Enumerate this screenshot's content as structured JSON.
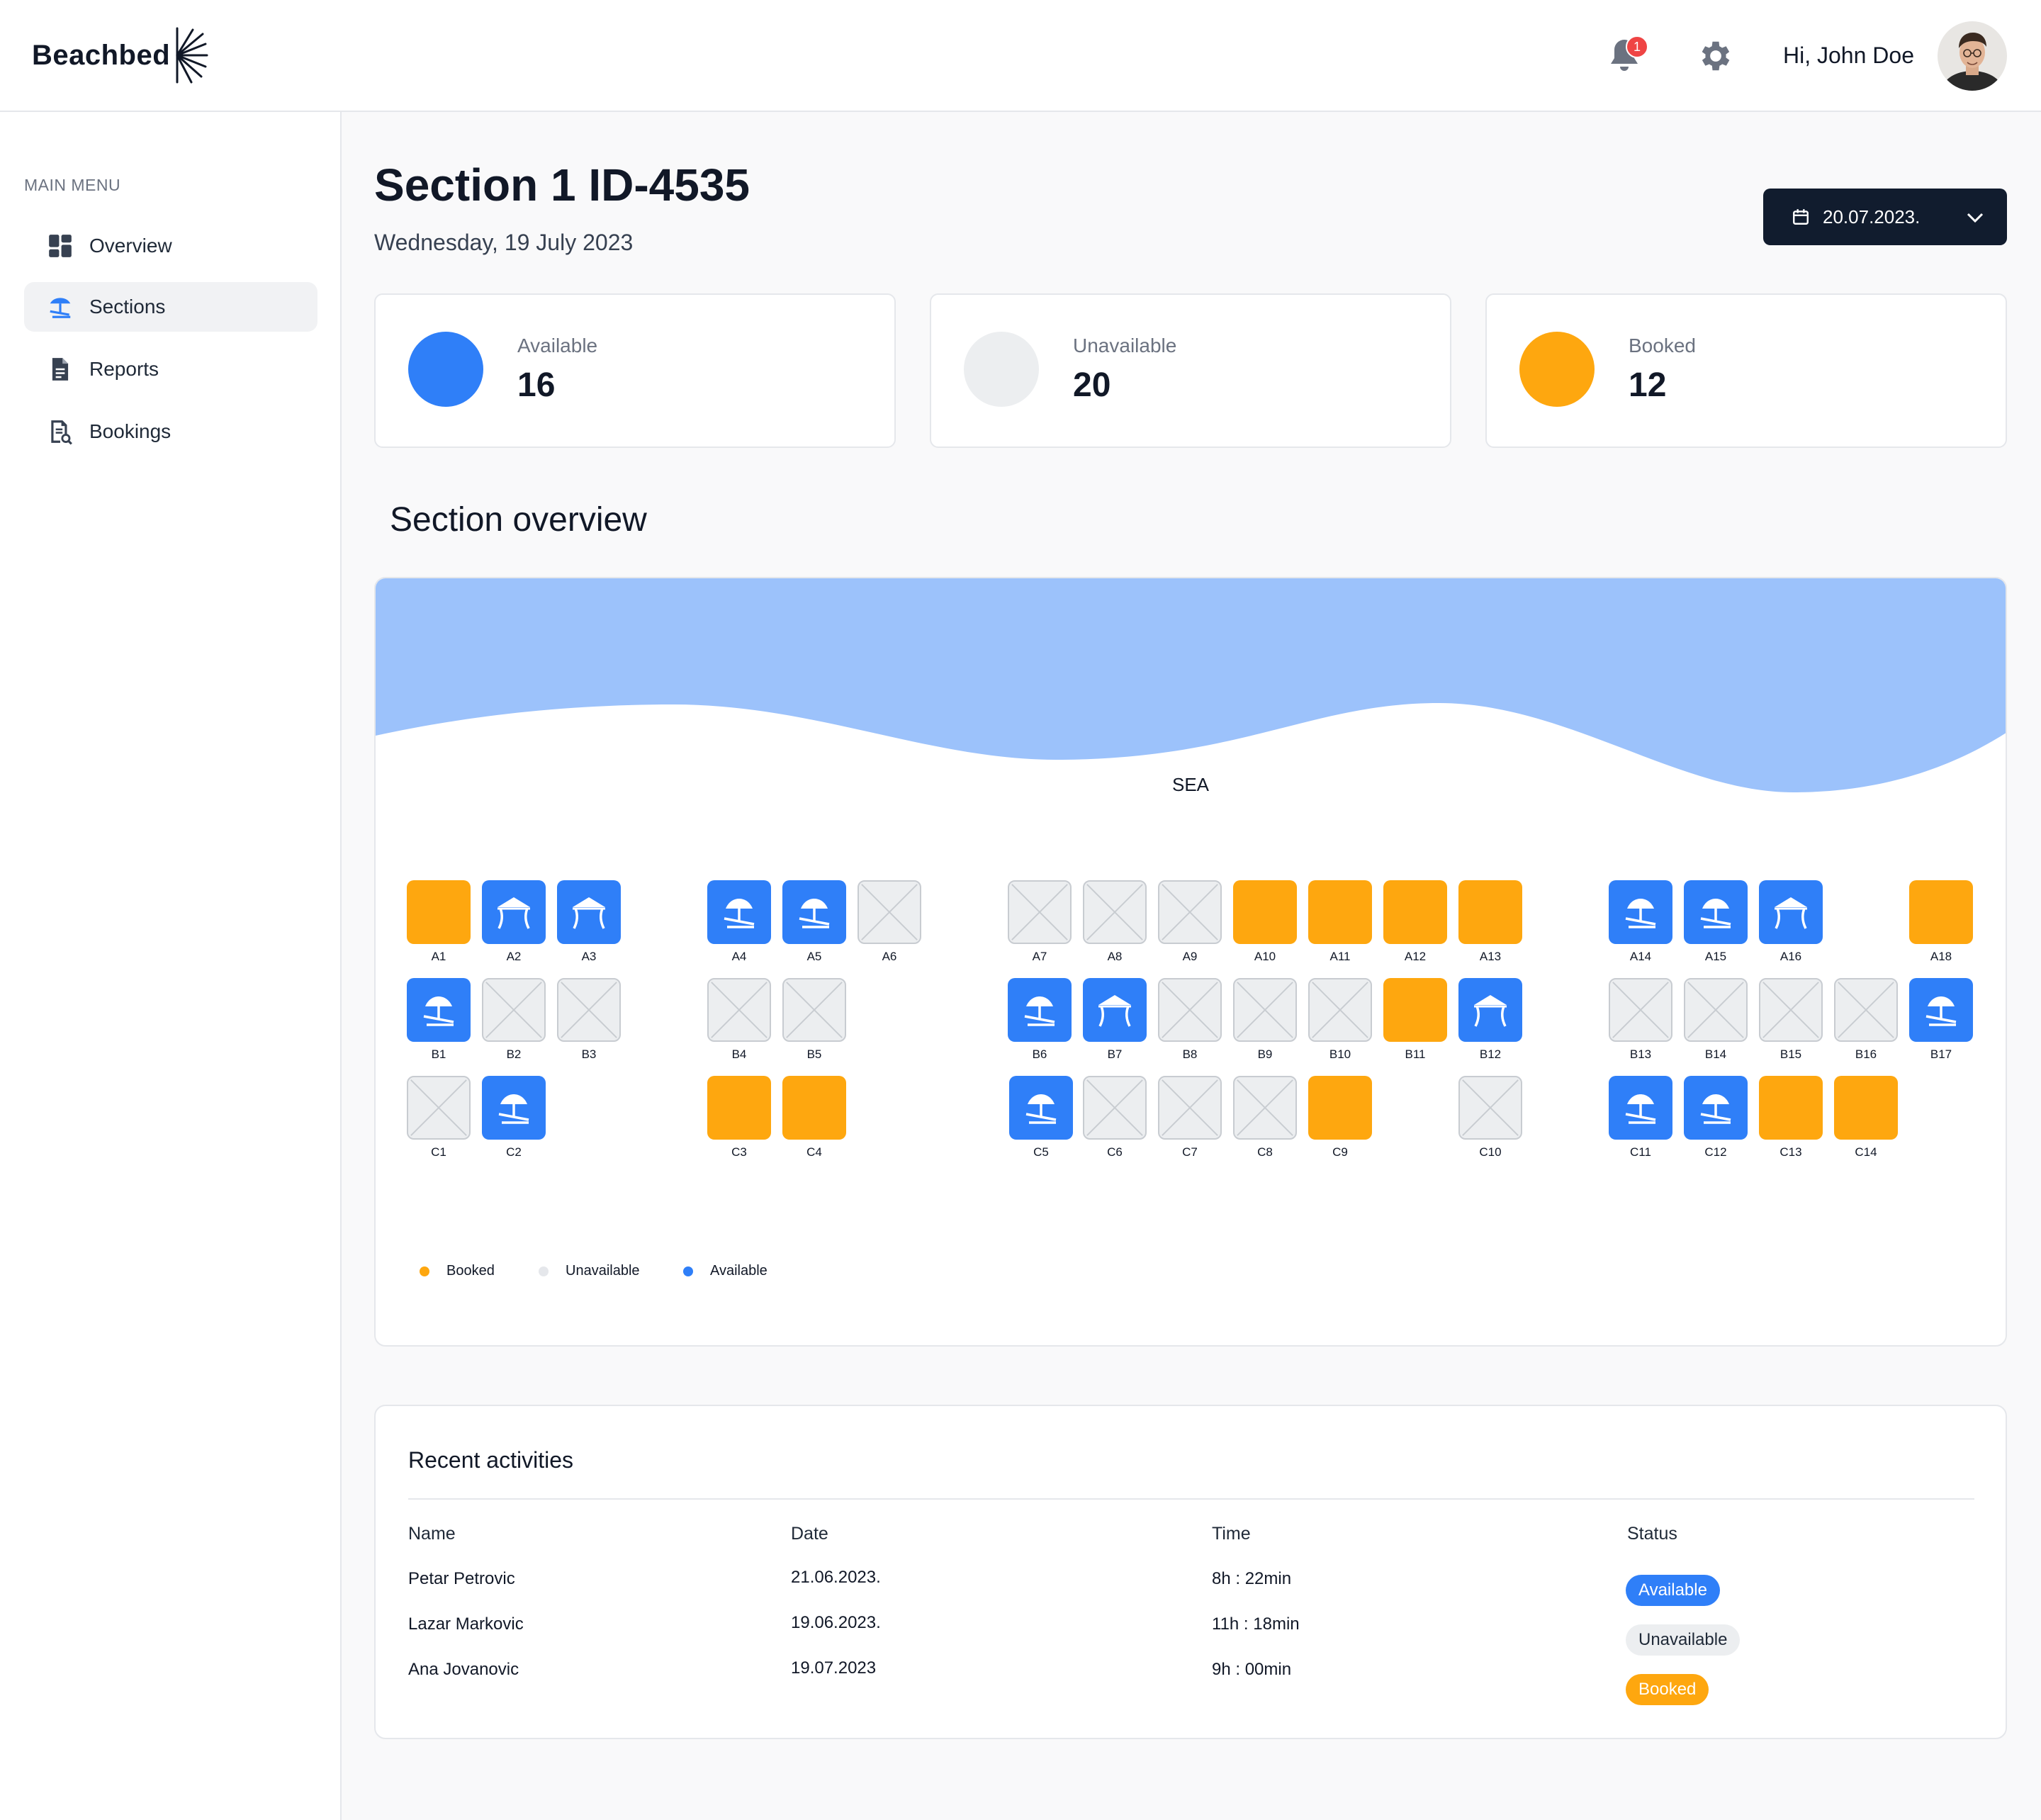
{
  "app": {
    "logo": "Beachbed"
  },
  "header": {
    "greeting": "Hi, John Doe",
    "notification_count": "1"
  },
  "sidebar": {
    "title": "MAIN MENU",
    "items": [
      {
        "label": "Overview",
        "icon": "grid-icon"
      },
      {
        "label": "Sections",
        "icon": "beach-icon",
        "active": true
      },
      {
        "label": "Reports",
        "icon": "document-icon"
      },
      {
        "label": "Bookings",
        "icon": "bookings-icon"
      }
    ]
  },
  "page": {
    "title": "Section 1 ID-4535",
    "date": "Wednesday, 19 July 2023",
    "date_picker": "20.07.2023."
  },
  "stats": [
    {
      "label": "Available",
      "value": "16",
      "color": "#2f7ff8"
    },
    {
      "label": "Unavailable",
      "value": "20",
      "color": "#eceef0"
    },
    {
      "label": "Booked",
      "value": "12",
      "color": "#fea70f"
    }
  ],
  "overview": {
    "title": "Section overview",
    "sea_label": "SEA",
    "legend": [
      {
        "label": "Booked",
        "color": "#fea70f"
      },
      {
        "label": "Unavailable",
        "color": "#eceef0"
      },
      {
        "label": "Available",
        "color": "#2f7ff8"
      }
    ],
    "spots": [
      {
        "id": "A1",
        "status": "booked",
        "icon": ""
      },
      {
        "id": "A2",
        "status": "available",
        "icon": "tent"
      },
      {
        "id": "A3",
        "status": "available",
        "icon": "tent"
      },
      {
        "id": "A4",
        "status": "available",
        "icon": "umbrella"
      },
      {
        "id": "A5",
        "status": "available",
        "icon": "umbrella"
      },
      {
        "id": "A6",
        "status": "unavailable",
        "icon": ""
      },
      {
        "id": "A7",
        "status": "unavailable",
        "icon": ""
      },
      {
        "id": "A8",
        "status": "unavailable",
        "icon": ""
      },
      {
        "id": "A9",
        "status": "unavailable",
        "icon": ""
      },
      {
        "id": "A10",
        "status": "booked",
        "icon": ""
      },
      {
        "id": "A11",
        "status": "booked",
        "icon": ""
      },
      {
        "id": "A12",
        "status": "booked",
        "icon": ""
      },
      {
        "id": "A13",
        "status": "booked",
        "icon": ""
      },
      {
        "id": "A14",
        "status": "available",
        "icon": "umbrella"
      },
      {
        "id": "A15",
        "status": "available",
        "icon": "umbrella"
      },
      {
        "id": "A16",
        "status": "available",
        "icon": "tent"
      },
      {
        "id": "A18",
        "status": "booked",
        "icon": ""
      },
      {
        "id": "B1",
        "status": "available",
        "icon": "umbrella"
      },
      {
        "id": "B2",
        "status": "unavailable",
        "icon": ""
      },
      {
        "id": "B3",
        "status": "unavailable",
        "icon": ""
      },
      {
        "id": "B4",
        "status": "unavailable",
        "icon": ""
      },
      {
        "id": "B5",
        "status": "unavailable",
        "icon": ""
      },
      {
        "id": "B6",
        "status": "available",
        "icon": "umbrella"
      },
      {
        "id": "B7",
        "status": "available",
        "icon": "tent"
      },
      {
        "id": "B8",
        "status": "unavailable",
        "icon": ""
      },
      {
        "id": "B9",
        "status": "unavailable",
        "icon": ""
      },
      {
        "id": "B10",
        "status": "unavailable",
        "icon": ""
      },
      {
        "id": "B11",
        "status": "booked",
        "icon": ""
      },
      {
        "id": "B12",
        "status": "available",
        "icon": "tent"
      },
      {
        "id": "B13",
        "status": "unavailable",
        "icon": ""
      },
      {
        "id": "B14",
        "status": "unavailable",
        "icon": ""
      },
      {
        "id": "B15",
        "status": "unavailable",
        "icon": ""
      },
      {
        "id": "B16",
        "status": "unavailable",
        "icon": ""
      },
      {
        "id": "B17",
        "status": "available",
        "icon": "umbrella"
      },
      {
        "id": "C1",
        "status": "unavailable",
        "icon": ""
      },
      {
        "id": "C2",
        "status": "available",
        "icon": "umbrella"
      },
      {
        "id": "C3",
        "status": "booked",
        "icon": ""
      },
      {
        "id": "C4",
        "status": "booked",
        "icon": ""
      },
      {
        "id": "C5",
        "status": "available",
        "icon": "umbrella"
      },
      {
        "id": "C6",
        "status": "unavailable",
        "icon": ""
      },
      {
        "id": "C7",
        "status": "unavailable",
        "icon": ""
      },
      {
        "id": "C8",
        "status": "unavailable",
        "icon": ""
      },
      {
        "id": "C9",
        "status": "booked",
        "icon": ""
      },
      {
        "id": "C10",
        "status": "unavailable",
        "icon": ""
      },
      {
        "id": "C11",
        "status": "available",
        "icon": "umbrella"
      },
      {
        "id": "C12",
        "status": "available",
        "icon": "umbrella"
      },
      {
        "id": "C13",
        "status": "booked",
        "icon": ""
      },
      {
        "id": "C14",
        "status": "booked",
        "icon": ""
      }
    ]
  },
  "activities": {
    "title": "Recent activities",
    "columns": [
      "Name",
      "Date",
      "Time",
      "Status"
    ],
    "rows": [
      {
        "name": "Petar Petrovic",
        "date": "21.06.2023.",
        "time": "8h : 22min",
        "status": "Available",
        "status_type": "available"
      },
      {
        "name": "Lazar Markovic",
        "date": "19.06.2023.",
        "time": "11h : 18min",
        "status": "Unavailable",
        "status_type": "unavailable"
      },
      {
        "name": "Ana Jovanovic",
        "date": "19.07.2023",
        "time": "9h : 00min",
        "status": "Booked",
        "status_type": "booked"
      }
    ]
  }
}
